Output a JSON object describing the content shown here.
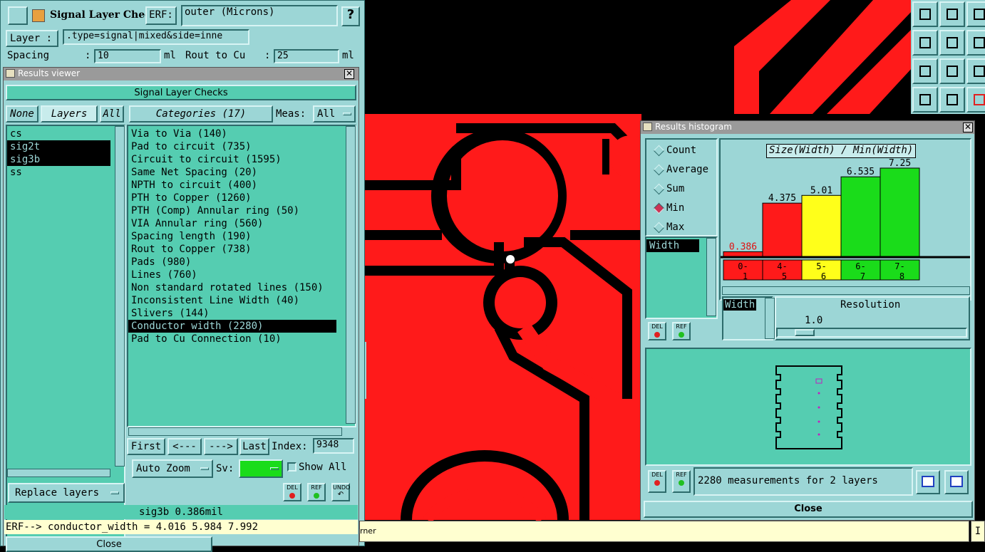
{
  "colors": {
    "panel": "#9cd6d6",
    "list_bg": "#55cdb1",
    "trace": "#ff1a1a",
    "selection": "#000000",
    "hist_red": "#ff1a1a",
    "hist_yellow": "#ffff1a",
    "hist_green": "#1adc1a",
    "status_bg": "#ffffd0"
  },
  "signal_checks": {
    "title": "Signal Layer Checks",
    "erf_label": "ERF:",
    "erf_value": "outer (Microns)",
    "help_label": "?",
    "layer_label": "Layer :",
    "layer_value": ".type=signal|mixed&side=inne",
    "spacing_label": "Spacing",
    "spacing_colon": ":",
    "spacing_value": "10",
    "spacing_unit": "ml",
    "rout_label": "Rout to Cu",
    "rout_colon": ":",
    "rout_value": "25",
    "rout_unit": "ml"
  },
  "results_viewer": {
    "window_title": "Results viewer",
    "header": "Signal Layer Checks",
    "none_label": "None",
    "layers_label": "Layers",
    "all_label": "All",
    "categories_label": "Categories (17)",
    "meas_label": "Meas:",
    "meas_value": "All",
    "layers": [
      "cs",
      "sig2t",
      "sig3b",
      "ss"
    ],
    "categories": [
      "Via to Via (140)",
      "Pad to circuit (735)",
      "Circuit to circuit (1595)",
      "Same Net Spacing (20)",
      "NPTH to circuit (400)",
      "PTH to Copper (1260)",
      "PTH (Comp) Annular ring (50)",
      "VIA Annular ring (560)",
      "Spacing length (190)",
      "Rout to Copper (738)",
      "Pads (980)",
      "Lines (760)",
      "Non standard rotated lines (150)",
      "Inconsistent Line Width (40)",
      "Slivers (144)",
      "Conductor width (2280)",
      "Pad to Cu Connection (10)"
    ],
    "first_label": "First",
    "prev_label": "<---",
    "next_label": "--->",
    "last_label": "Last",
    "index_label": "Index:",
    "index_value": "9348",
    "auto_zoom_label": "Auto Zoom",
    "sv_label": "Sv:",
    "show_all_label": "Show All",
    "replace_layers_label": "Replace layers",
    "del_label": "DEL",
    "ref_label": "REF",
    "undo_label": "UNDO",
    "status_text": "sig3b 0.386mil",
    "erf_line": "ERF--> conductor_width = 4.016 5.984 7.992",
    "close_label": "Close"
  },
  "histogram": {
    "window_title": "Results histogram",
    "title": "Size(Width) / Min(Width)",
    "modes": [
      "Count",
      "Average",
      "Sum",
      "Min",
      "Max"
    ],
    "selected_mode": "Min",
    "list_item": "Width",
    "resolution_list_item": "Width",
    "resolution_label": "Resolution",
    "resolution_value": "1.0",
    "resolution_slider": 0.1,
    "del_label": "DEL",
    "ref_label": "REF",
    "measurements_text": "2280 measurements for 2 layers",
    "close_label": "Close"
  },
  "chart_data": {
    "type": "bar",
    "title": "Size(Width) / Min(Width)",
    "categories": [
      "0-1",
      "4-5",
      "5-6",
      "6-7",
      "7-8"
    ],
    "values": [
      0.386,
      4.375,
      5.01,
      6.535,
      7.25
    ],
    "value_labels": [
      "0.386",
      "4.375",
      "5.01",
      "6.535",
      "7.25"
    ],
    "category_top": [
      "0-",
      "4-",
      "5-",
      "6-",
      "7-"
    ],
    "category_bottom": [
      "1",
      "5",
      "6",
      "7",
      "8"
    ],
    "colors": [
      "#ff1a1a",
      "#ff1a1a",
      "#ffff1a",
      "#1adc1a",
      "#1adc1a"
    ],
    "ylim": [
      0,
      7.25
    ]
  },
  "bottom_bar": {
    "text": "rner",
    "right_text": "I"
  }
}
